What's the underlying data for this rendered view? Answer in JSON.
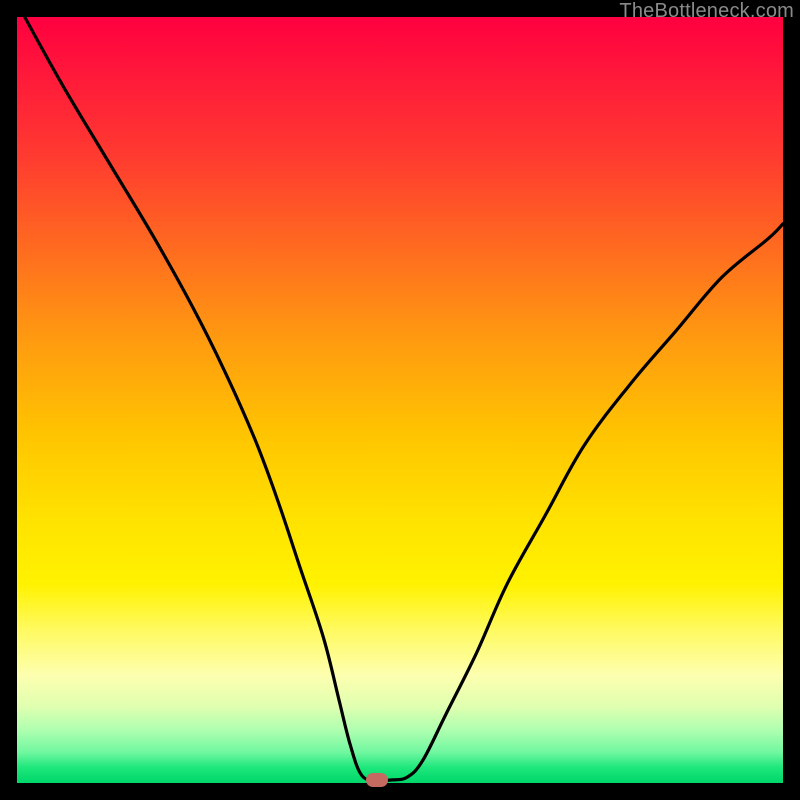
{
  "watermark": "TheBottleneck.com",
  "chart_data": {
    "type": "line",
    "title": "",
    "xlabel": "",
    "ylabel": "",
    "xlim": [
      0,
      100
    ],
    "ylim": [
      0,
      100
    ],
    "grid": false,
    "series": [
      {
        "name": "curve",
        "x": [
          1,
          6,
          12,
          18,
          23,
          27,
          31,
          34,
          37,
          40,
          42,
          43.5,
          45,
          47,
          49,
          51,
          53,
          56,
          60,
          64,
          69,
          74,
          80,
          86,
          92,
          98,
          100
        ],
        "y": [
          100,
          91,
          81,
          71,
          62,
          54,
          45,
          37,
          28,
          19,
          11,
          5,
          1,
          0.4,
          0.4,
          0.8,
          3,
          9,
          17,
          26,
          35,
          44,
          52,
          59,
          66,
          71,
          73
        ]
      }
    ],
    "marker": {
      "x": 47,
      "y": 0.4,
      "color": "#c56a60"
    },
    "gradient_stops": [
      {
        "pos": 0,
        "color": "#ff0040"
      },
      {
        "pos": 50,
        "color": "#ffe300"
      },
      {
        "pos": 100,
        "color": "#00d66a"
      }
    ]
  }
}
